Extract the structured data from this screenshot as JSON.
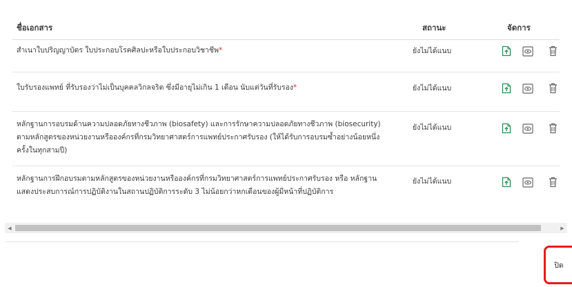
{
  "table": {
    "headers": {
      "name": "ชื่อเอกสาร",
      "status": "สถานะ",
      "actions": "จัดการ"
    },
    "rows": [
      {
        "name": "สำเนาใบปริญญาบัตร ใบประกอบโรคศิลปะหรือใบประกอบวิชาชีพ",
        "required": "*",
        "status": "ยังไม่ได้แนบ"
      },
      {
        "name": "ใบรับรองแพทย์ ที่รับรองว่าไม่เป็นบุคคลวิกลจริต ซึ่งมีอายุไม่เกิน 1 เดือน นับแต่วันที่รับรอง",
        "required": "*",
        "status": "ยังไม่ได้แนบ"
      },
      {
        "name": "หลักฐานการอบรมด้านความปลอดภัยทางชีวภาพ (biosafety) และการรักษาความปลอดภัยทางชีวภาพ (biosecurity) ตามหลักสูตรของหน่วยงานหรือองค์กรที่กรมวิทยาศาสตร์การแพทย์ประกาศรับรอง (ให้ได้รับการอบรมซ้ำอย่างน้อยหนึ่งครั้งในทุกสามปี)",
        "required": "",
        "status": "ยังไม่ได้แนบ"
      },
      {
        "name": "หลักฐานการฝึกอบรมตามหลักสูตรของหน่วยงานหรือองค์กรที่กรมวิทยาศาสตร์การแพทย์ประกาศรับรอง หรือ หลักฐานแสดงประสบการณ์การปฏิบัติงานในสถานปฏิบัติการระดับ 3 ไม่น้อยกว่าหกเดือนของผู้มีหน้าที่ปฏิบัติการ",
        "required": "",
        "status": "ยังไม่ได้แนบ"
      }
    ]
  },
  "icons": {
    "upload": "upload-file-icon",
    "view": "eye-icon",
    "delete": "trash-icon"
  },
  "colors": {
    "upload": "#2e8b57",
    "required": "#d42a2a",
    "highlight": "#e41b1b"
  },
  "scrollbar": {
    "left_arrow": "◀",
    "right_arrow": "▶"
  },
  "footer": {
    "close_label": "ปิด"
  }
}
